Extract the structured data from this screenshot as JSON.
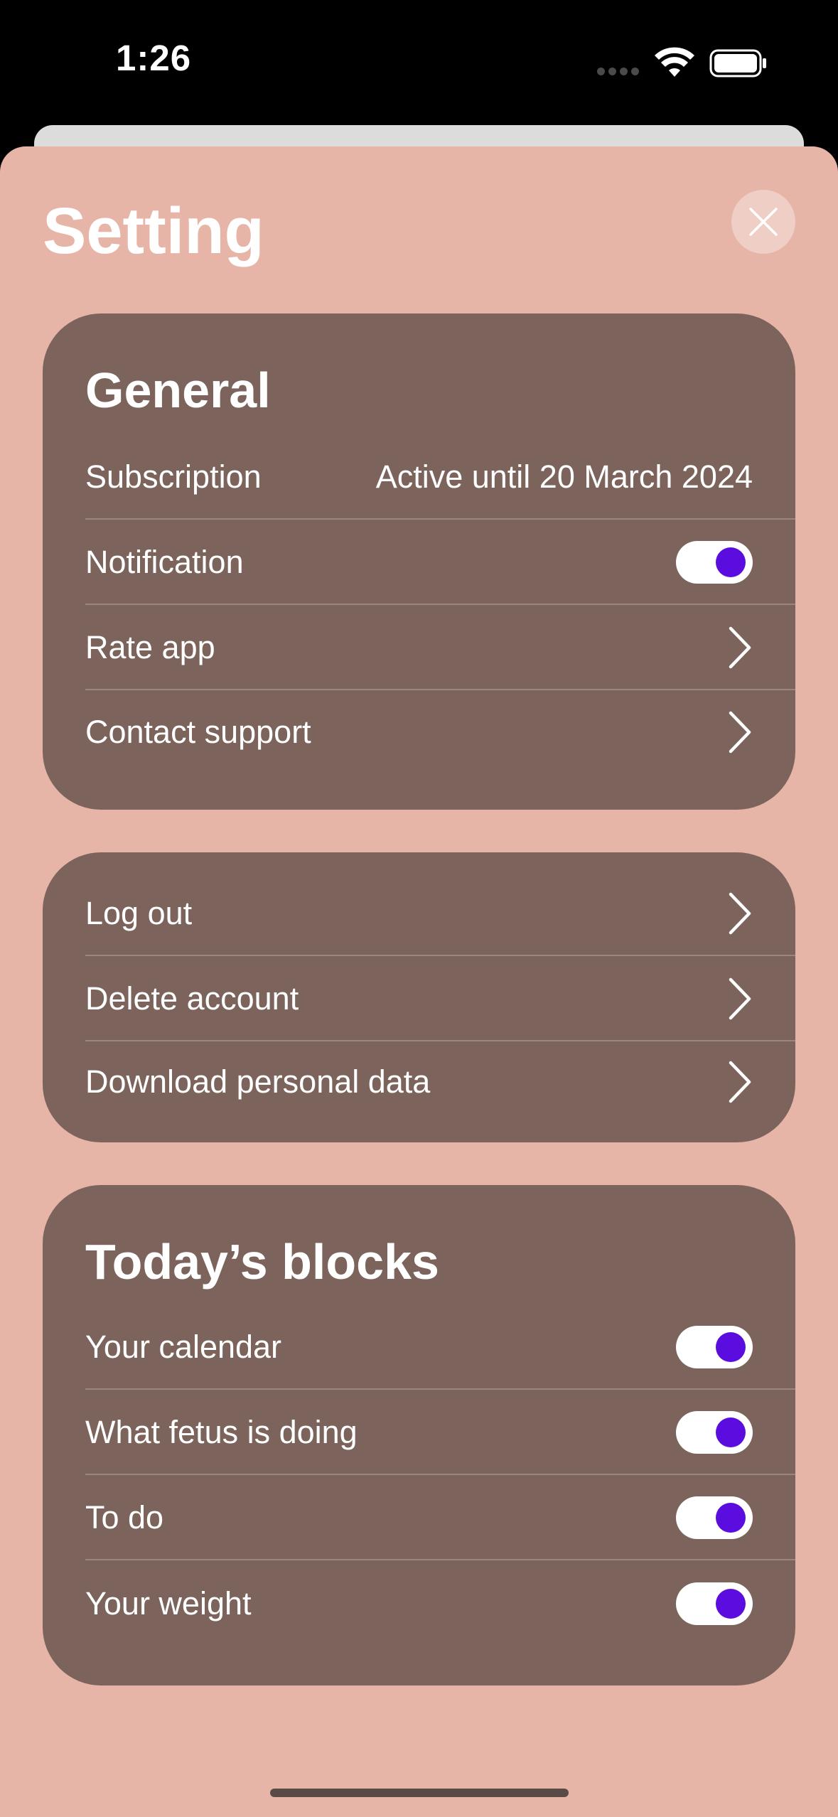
{
  "status_bar": {
    "time": "1:26"
  },
  "header": {
    "title": "Setting",
    "close_icon": "close-icon"
  },
  "general": {
    "heading": "General",
    "subscription_label": "Subscription",
    "subscription_value": "Active until 20 March 2024",
    "notification_label": "Notification",
    "notification_on": true,
    "rate_label": "Rate app",
    "support_label": "Contact support"
  },
  "account": {
    "logout_label": "Log out",
    "delete_label": "Delete account",
    "download_label": "Download personal data"
  },
  "blocks": {
    "heading": "Today’s blocks",
    "items": [
      {
        "label": "Your calendar",
        "on": true
      },
      {
        "label": "What fetus is doing",
        "on": true
      },
      {
        "label": "To do",
        "on": true
      },
      {
        "label": "Your weight",
        "on": true
      }
    ]
  },
  "colors": {
    "sheet_background": "#e6b5a7",
    "card_background": "#7c645c",
    "toggle_accent": "#5b0de0"
  }
}
